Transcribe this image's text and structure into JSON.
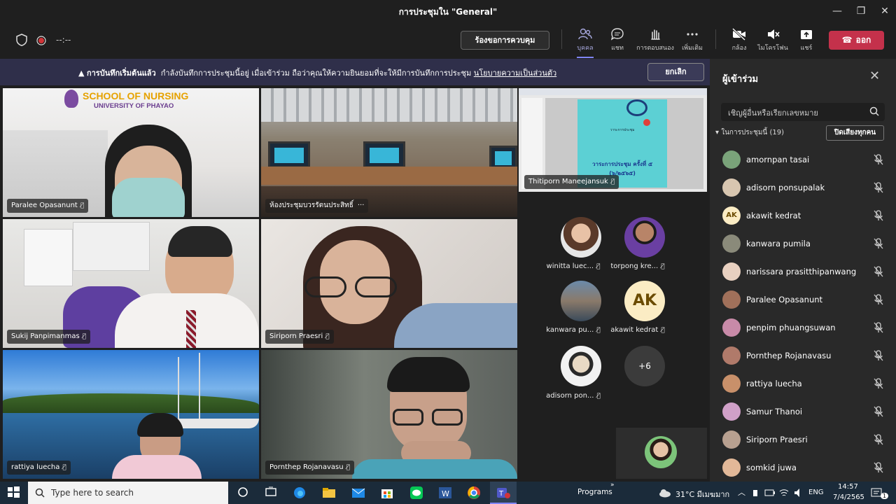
{
  "window": {
    "title": "การประชุมใน \"General\"",
    "minimize": "—",
    "maximize": "❐",
    "close": "✕"
  },
  "toolbar": {
    "timer": "--:--",
    "request_control": "ร้องขอการควบคุม",
    "items": {
      "people": "บุคคล",
      "chat": "แชท",
      "reactions": "การตอบสนอง",
      "more": "เพิ่มเติม",
      "camera": "กล้อง",
      "mic": "ไมโครโฟน",
      "share": "แชร์"
    },
    "leave": "ออก"
  },
  "banner": {
    "bold": "การบันทึกเริ่มต้นแล้ว",
    "text": "กำลังบันทึกการประชุมนี้อยู่ เมื่อเข้าร่วม ถือว่าคุณให้ความยินยอมที่จะให้มีการบันทึกการประชุม",
    "link": "นโยบายความเป็นส่วนตัว",
    "cancel": "ยกเลิก"
  },
  "tiles": {
    "t1": {
      "name": "Paralee Opasanunt",
      "logo_line1": "SCHOOL OF NURSING",
      "logo_line2": "UNIVERSITY OF PHAYAO"
    },
    "t2": {
      "name": "ห้องประชุมบวรรัตนประสิทธิ์",
      "more": "···"
    },
    "t3": {
      "name": "Thitiporn Maneejansuk",
      "slide_line1": "วาระการประชุม",
      "slide_line2": "วาระการประชุม ครั้งที่ ๕ (๖/๒๕๖๕)"
    },
    "t4": {
      "name": "Sukij Panpimanmas"
    },
    "t5": {
      "name": "Siriporn Praesri"
    },
    "t6": {
      "name": "rattiya luecha"
    },
    "t7": {
      "name": "Pornthep Rojanavasu"
    }
  },
  "bubbles": {
    "b1": "winitta luec...",
    "b2": "torpong kre...",
    "b3": "kanwara pu...",
    "b4": "akawit kedrat",
    "b4_initials": "AK",
    "b5": "adisorn pon...",
    "more_count": "+6"
  },
  "panel": {
    "title": "ผู้เข้าร่วม",
    "search_placeholder": "เชิญผู้อื่นหรือเรียกเลขหมาย",
    "group": "ในการประชุมนี้ (19)",
    "mute_all": "ปิดเสียงทุกคน",
    "participants": [
      {
        "name": "amornpan tasai",
        "initials": ""
      },
      {
        "name": "adisorn ponsupalak",
        "initials": ""
      },
      {
        "name": "akawit kedrat",
        "initials": "AK"
      },
      {
        "name": "kanwara pumila",
        "initials": ""
      },
      {
        "name": "narissara prasitthipanwang",
        "initials": ""
      },
      {
        "name": "Paralee Opasanunt",
        "initials": ""
      },
      {
        "name": "penpim phuangsuwan",
        "initials": ""
      },
      {
        "name": "Pornthep Rojanavasu",
        "initials": ""
      },
      {
        "name": "rattiya luecha",
        "initials": ""
      },
      {
        "name": "Samur Thanoi",
        "initials": ""
      },
      {
        "name": "Siriporn Praesri",
        "initials": ""
      },
      {
        "name": "somkid juwa",
        "initials": ""
      }
    ]
  },
  "taskbar": {
    "search": "Type here to search",
    "programs": "Programs",
    "programs_chevron": "»",
    "weather": "31°C มีเมฆมาก",
    "lang": "ENG",
    "time": "14:57",
    "date": "7/4/2565",
    "notif_count": "1"
  },
  "colors": {
    "accent": "#7f85f5",
    "leave": "#c4314b",
    "banner": "#2f2f4a",
    "panel": "#292929"
  }
}
